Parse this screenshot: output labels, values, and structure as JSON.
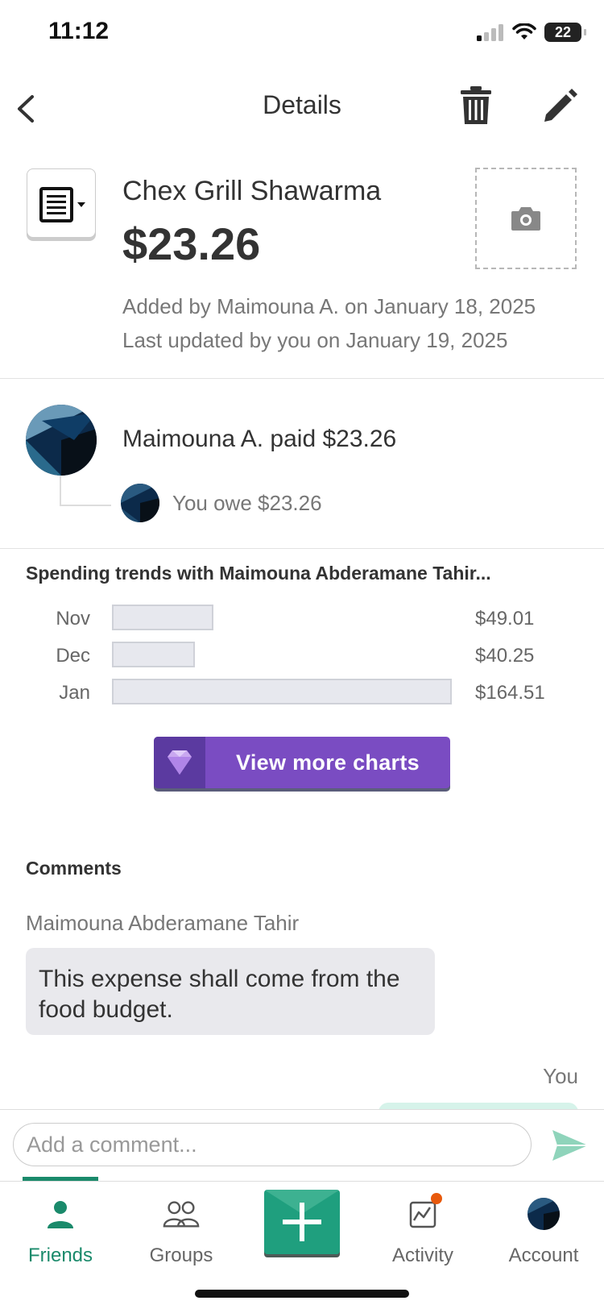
{
  "status_bar": {
    "time": "11:12",
    "battery": "22"
  },
  "header": {
    "title": "Details"
  },
  "expense": {
    "name": "Chex Grill Shawarma",
    "amount": "$23.26",
    "added_by": "Added by Maimouna A. on January 18, 2025",
    "updated_by": "Last updated by you on January 19, 2025"
  },
  "payment": {
    "paid_text": "Maimouna A. paid $23.26",
    "owe_text": "You owe $23.26"
  },
  "trends": {
    "title": "Spending trends with Maimouna Abderamane Tahir..."
  },
  "chart_data": {
    "type": "bar",
    "categories": [
      "Nov",
      "Dec",
      "Jan"
    ],
    "values": [
      49.01,
      40.25,
      164.51
    ],
    "value_labels": [
      "$49.01",
      "$40.25",
      "$164.51"
    ],
    "orientation": "horizontal",
    "colors": {
      "bar": "#e7e8ee",
      "border": "#cfd1d8"
    }
  },
  "charts_button": {
    "label": "View more charts",
    "color": "#7a4cc2"
  },
  "comments": {
    "title": "Comments",
    "items": [
      {
        "author": "Maimouna Abderamane Tahir",
        "text": "This expense shall come from the food budget."
      }
    ],
    "you_label": "You",
    "placeholder": "Add a comment..."
  },
  "tabs": [
    {
      "label": "Friends",
      "icon": "person-icon",
      "active": true
    },
    {
      "label": "Groups",
      "icon": "group-icon",
      "active": false
    },
    {
      "label": "Activity",
      "icon": "activity-icon",
      "active": false
    },
    {
      "label": "Account",
      "icon": "avatar-icon",
      "active": false
    }
  ],
  "colors": {
    "brand": "#1f9f7e",
    "accent": "#1a8a6b",
    "notification": "#e8590c"
  }
}
